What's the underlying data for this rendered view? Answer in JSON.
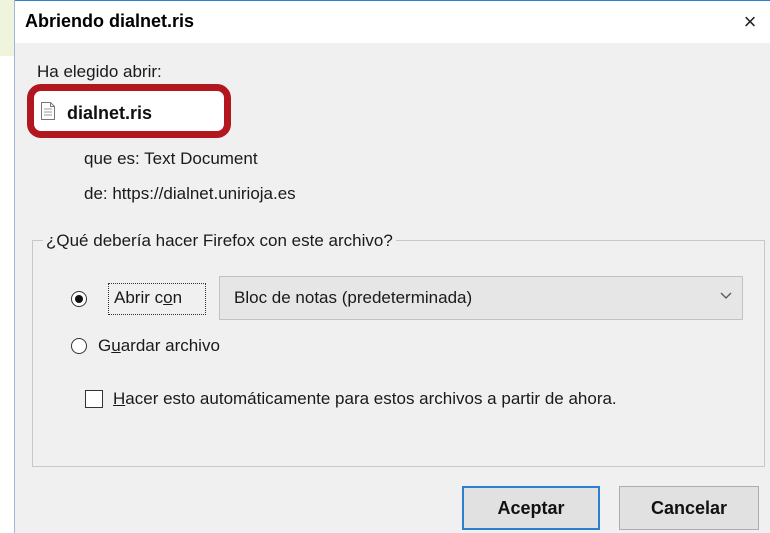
{
  "window": {
    "title": "Abriendo dialnet.ris",
    "close_glyph": "×"
  },
  "intro": {
    "label": "Ha elegido abrir:"
  },
  "file": {
    "name": "dialnet.ris",
    "type_line": "que es: Text Document",
    "source_line": "de: https://dialnet.unirioja.es"
  },
  "options": {
    "legend": "¿Qué debería hacer Firefox con este archivo?",
    "open_with": {
      "pre": "Abrir c",
      "accel": "o",
      "post": "n",
      "checked": true
    },
    "app_select": {
      "value": "Bloc de notas (predeterminada)"
    },
    "save_file": {
      "pre": "G",
      "accel": "u",
      "post": "ardar archivo",
      "checked": false
    },
    "auto": {
      "accel": "H",
      "post": "acer esto automáticamente para estos archivos a partir de ahora.",
      "checked": false
    }
  },
  "buttons": {
    "accept": "Aceptar",
    "cancel": "Cancelar"
  },
  "colors": {
    "highlight_border": "#b2171f",
    "focus_border": "#2f7fd1",
    "dialog_bg": "#f0f0f0"
  }
}
